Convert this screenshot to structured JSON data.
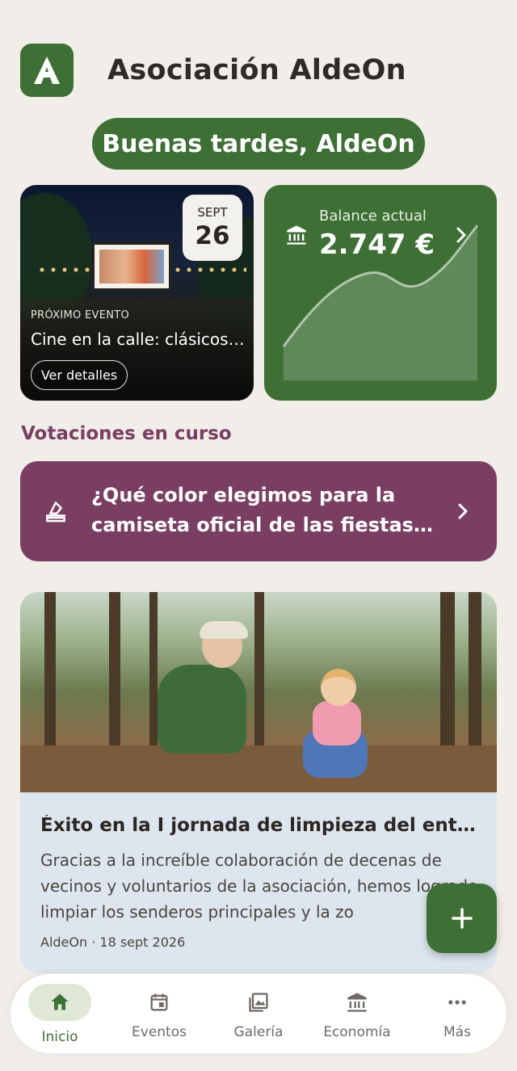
{
  "header": {
    "title": "Asociación AldeOn",
    "logo_letter": "A"
  },
  "greeting": "Buenas tardes, AldeOn",
  "event": {
    "month": "SEPT",
    "day": "26",
    "eyebrow": "PRÓXIMO EVENTO",
    "title": "Cine en la calle: clásicos ...",
    "details_label": "Ver detalles"
  },
  "balance": {
    "label": "Balance actual",
    "value": "2.747 €"
  },
  "votes": {
    "section_title": "Votaciones en curso",
    "question": "¿Qué color elegimos para la camiseta oficial de las fiestas de..."
  },
  "news": {
    "title": "Éxito en la I jornada de limpieza del ento...",
    "body": "Gracias a la increíble colaboración de decenas de vecinos y voluntarios de la asociación, hemos logrado limpiar los senderos principales y la zo",
    "meta": "AldeOn · 18 sept 2026"
  },
  "fab": {
    "label": "+"
  },
  "nav": {
    "items": [
      {
        "label": "Inicio",
        "icon": "home-icon",
        "active": true
      },
      {
        "label": "Eventos",
        "icon": "calendar-icon",
        "active": false
      },
      {
        "label": "Galería",
        "icon": "gallery-icon",
        "active": false
      },
      {
        "label": "Economía",
        "icon": "bank-icon",
        "active": false
      },
      {
        "label": "Más",
        "icon": "more-icon",
        "active": false
      }
    ]
  },
  "colors": {
    "primary_green": "#3e6f35",
    "vote_purple": "#7a3e63",
    "background": "#f1ede8",
    "news_card_bg": "#dde6ef"
  }
}
